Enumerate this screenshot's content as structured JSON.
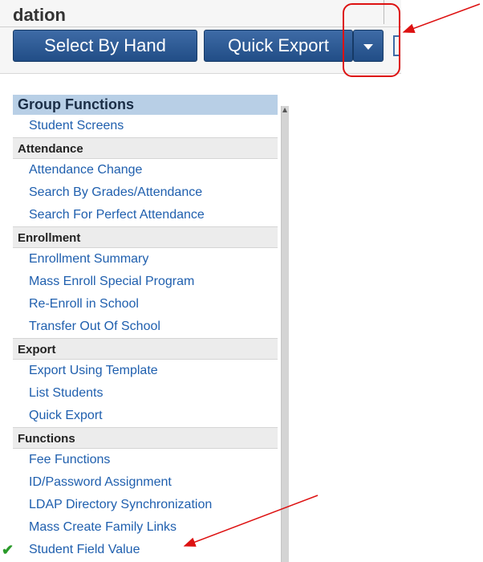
{
  "toolbar": {
    "section_title": "dation",
    "select_by_hand_label": "Select By Hand",
    "quick_export_label": "Quick Export",
    "dropdown_icon": "caret-down-icon"
  },
  "menu": {
    "header": "Group Functions",
    "top_items": [
      "Student Screens"
    ],
    "sections": [
      {
        "title": "Attendance",
        "items": [
          "Attendance Change",
          "Search By Grades/Attendance",
          "Search For Perfect Attendance"
        ]
      },
      {
        "title": "Enrollment",
        "items": [
          "Enrollment Summary",
          "Mass Enroll Special Program",
          "Re-Enroll in School",
          "Transfer Out Of School"
        ]
      },
      {
        "title": "Export",
        "items": [
          "Export Using Template",
          "List Students",
          "Quick Export"
        ]
      },
      {
        "title": "Functions",
        "items": [
          "Fee Functions",
          "ID/Password Assignment",
          "LDAP Directory Synchronization",
          "Mass Create Family Links",
          "Student Field Value"
        ]
      }
    ],
    "checked_item": "Student Field Value"
  },
  "colors": {
    "button_blue": "#2b5a94",
    "header_blue": "#b8cfe6",
    "link_blue": "#1f5fae",
    "annotation_red": "#dd1111",
    "check_green": "#2a9a2a"
  }
}
